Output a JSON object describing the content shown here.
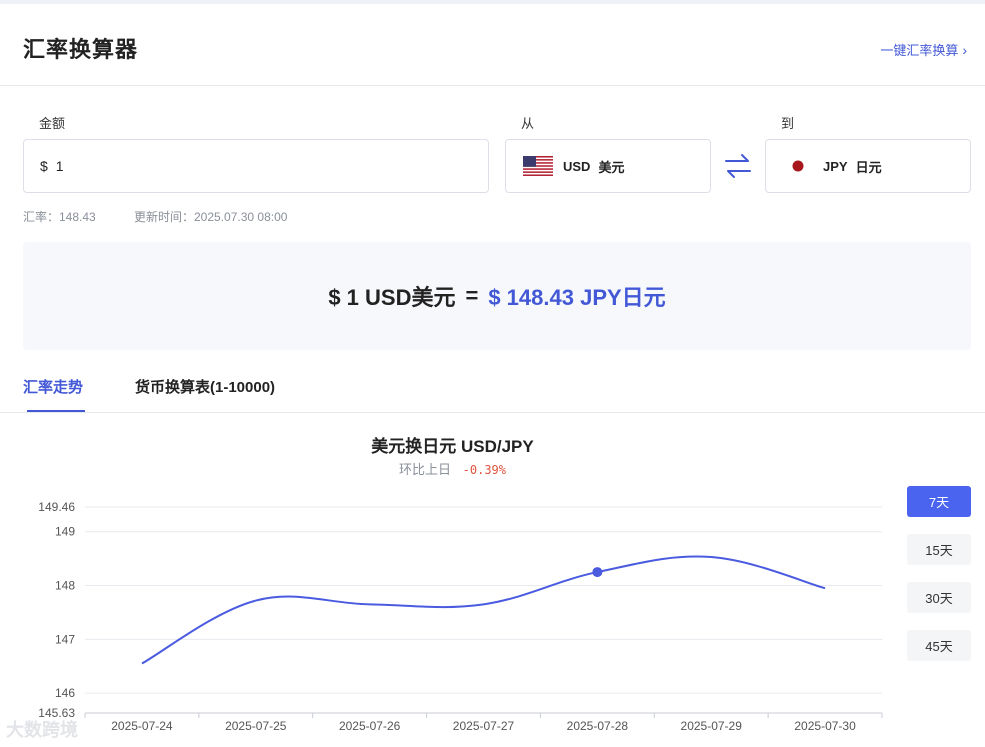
{
  "header": {
    "title": "汇率换算器",
    "oneclick_label": "一键汇率换算"
  },
  "form": {
    "amount_label": "金额",
    "amount_symbol": "$",
    "amount_value": "1",
    "from_label": "从",
    "from_code": "USD",
    "from_name": "美元",
    "to_label": "到",
    "to_code": "JPY",
    "to_name": "日元",
    "rate_text": "汇率：148.43",
    "updated_text": "更新时间：2025.07.30 08:00"
  },
  "result": {
    "left": "$ 1 USD美元",
    "eq": "=",
    "right": "$ 148.43 JPY日元"
  },
  "tabs": [
    {
      "label": "汇率走势"
    },
    {
      "label": "货币换算表(1-10000)"
    }
  ],
  "chart": {
    "title": "美元换日元  USD/JPY",
    "compare_label": "环比上日",
    "compare_value": "-0.39%"
  },
  "range_buttons": [
    {
      "label": "7天"
    },
    {
      "label": "15天"
    },
    {
      "label": "30天"
    },
    {
      "label": "45天"
    }
  ],
  "watermark": "大数跨境",
  "colors": {
    "accent": "#4358d6",
    "line": "#4a5be0",
    "negative": "#e0533f"
  },
  "chart_data": {
    "type": "line",
    "title": "美元换日元  USD/JPY",
    "x": [
      "2025-07-24",
      "2025-07-25",
      "2025-07-26",
      "2025-07-27",
      "2025-07-28",
      "2025-07-29",
      "2025-07-30"
    ],
    "series": [
      {
        "values": [
          146.55,
          147.72,
          147.65,
          147.65,
          148.25,
          148.53,
          147.95
        ]
      }
    ],
    "y_ticks": [
      145.63,
      146,
      147,
      148,
      149,
      149.46
    ],
    "ylim": [
      145.63,
      149.46
    ],
    "highlight_index": 4,
    "grid": true
  }
}
